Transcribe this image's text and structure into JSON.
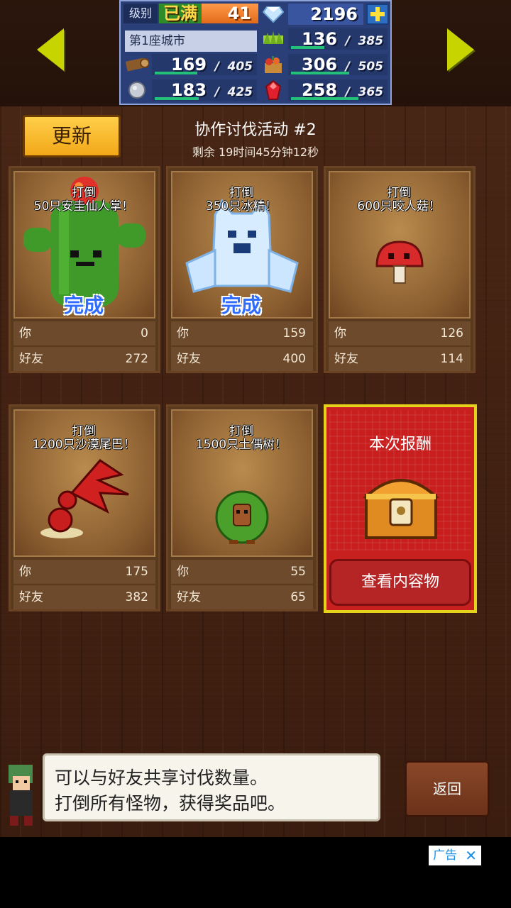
{
  "top": {
    "level_label": "级别",
    "level_max": "已满",
    "level_value": "41",
    "gems": "2196",
    "city": "第1座城市",
    "resources": [
      {
        "icon": "grass-icon",
        "current": "136",
        "max": "385",
        "progress": 0.35
      },
      {
        "icon": "wood-log-icon",
        "current": "169",
        "max": "405",
        "progress": 0.42
      },
      {
        "icon": "food-basket-icon",
        "current": "306",
        "max": "505",
        "progress": 0.61
      },
      {
        "icon": "stone-icon",
        "current": "183",
        "max": "425",
        "progress": 0.43
      },
      {
        "icon": "ruby-icon",
        "current": "258",
        "max": "365",
        "progress": 0.71
      }
    ]
  },
  "header": {
    "refresh": "更新",
    "title": "协作讨伐活动 #2",
    "time": "剩余 19时间45分钟12秒"
  },
  "cards": [
    {
      "line1": "打倒",
      "line2": "50只安圭仙人掌！",
      "done": "完成",
      "you_label": "你",
      "you": "0",
      "friend_label": "好友",
      "friend": "272"
    },
    {
      "line1": "打倒",
      "line2": "350只冰精！",
      "done": "完成",
      "you_label": "你",
      "you": "159",
      "friend_label": "好友",
      "friend": "400"
    },
    {
      "line1": "打倒",
      "line2": "600只咬人菇！",
      "done": "",
      "you_label": "你",
      "you": "126",
      "friend_label": "好友",
      "friend": "114"
    },
    {
      "line1": "打倒",
      "line2": "1200只沙漠尾巴！",
      "done": "",
      "you_label": "你",
      "you": "175",
      "friend_label": "好友",
      "friend": "382"
    },
    {
      "line1": "打倒",
      "line2": "1500只土偶树！",
      "done": "",
      "you_label": "你",
      "you": "55",
      "friend_label": "好友",
      "friend": "65"
    }
  ],
  "reward": {
    "title": "本次报酬",
    "button": "查看内容物"
  },
  "footer": {
    "line1": "可以与好友共享讨伐数量。",
    "line2": "打倒所有怪物，获得奖品吧。",
    "back": "返回"
  },
  "ad": {
    "label": "广告",
    "close": "✕"
  }
}
